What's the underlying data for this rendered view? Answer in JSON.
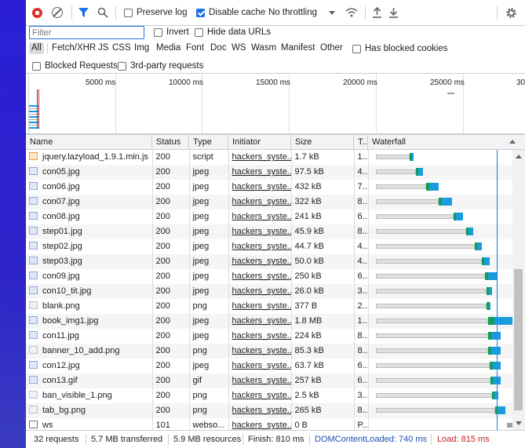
{
  "toolbar": {
    "preserve_log": "Preserve log",
    "disable_cache": "Disable cache",
    "throttling": "No throttling"
  },
  "filter": {
    "value": "Filter",
    "invert": "Invert",
    "hide_data_urls": "Hide data URLs",
    "types": [
      "All",
      "Fetch/XHR",
      "JS",
      "CSS",
      "Img",
      "Media",
      "Font",
      "Doc",
      "WS",
      "Wasm",
      "Manifest",
      "Other"
    ],
    "has_blocked_cookies": "Has blocked cookies",
    "blocked_requests": "Blocked Requests",
    "third_party": "3rd-party requests"
  },
  "overview": {
    "ticks": [
      "5000 ms",
      "10000 ms",
      "15000 ms",
      "20000 ms",
      "25000 ms",
      "30"
    ]
  },
  "columns": {
    "name": "Name",
    "status": "Status",
    "type": "Type",
    "initiator": "Initiator",
    "size": "Size",
    "time": "T...",
    "waterfall": "Waterfall"
  },
  "rows": [
    {
      "name": "jquery.lazyload_1.9.1.min.js",
      "status": "200",
      "type": "script",
      "initiator": "hackers_syste...",
      "size": "1.7 kB",
      "time": "1...",
      "icon": "js",
      "wf": [
        0.29,
        0.31
      ]
    },
    {
      "name": "con05.jpg",
      "status": "200",
      "type": "jpeg",
      "initiator": "hackers_syste...",
      "size": "97.5 kB",
      "time": "4...",
      "icon": "img",
      "wf": [
        0.33,
        0.38
      ]
    },
    {
      "name": "con06.jpg",
      "status": "200",
      "type": "jpeg",
      "initiator": "hackers_syste...",
      "size": "432 kB",
      "time": "7...",
      "icon": "img",
      "wf": [
        0.4,
        0.49
      ]
    },
    {
      "name": "con07.jpg",
      "status": "200",
      "type": "jpeg",
      "initiator": "hackers_syste...",
      "size": "322 kB",
      "time": "8...",
      "icon": "img",
      "wf": [
        0.49,
        0.58
      ]
    },
    {
      "name": "con08.jpg",
      "status": "200",
      "type": "jpeg",
      "initiator": "hackers_syste...",
      "size": "241 kB",
      "time": "6...",
      "icon": "img",
      "wf": [
        0.59,
        0.66
      ]
    },
    {
      "name": "step01.jpg",
      "status": "200",
      "type": "jpeg",
      "initiator": "hackers_syste...",
      "size": "45.9 kB",
      "time": "8...",
      "icon": "img",
      "wf": [
        0.68,
        0.73
      ]
    },
    {
      "name": "step02.jpg",
      "status": "200",
      "type": "jpeg",
      "initiator": "hackers_syste...",
      "size": "44.7 kB",
      "time": "4...",
      "icon": "img",
      "wf": [
        0.74,
        0.79
      ]
    },
    {
      "name": "step03.jpg",
      "status": "200",
      "type": "jpeg",
      "initiator": "hackers_syste...",
      "size": "50.0 kB",
      "time": "4...",
      "icon": "img",
      "wf": [
        0.79,
        0.84
      ]
    },
    {
      "name": "con09.jpg",
      "status": "200",
      "type": "jpeg",
      "initiator": "hackers_syste...",
      "size": "250 kB",
      "time": "6...",
      "icon": "img",
      "wf": [
        0.81,
        0.89
      ]
    },
    {
      "name": "con10_tit.jpg",
      "status": "200",
      "type": "jpeg",
      "initiator": "hackers_syste...",
      "size": "26.0 kB",
      "time": "3...",
      "icon": "img",
      "wf": [
        0.82,
        0.86
      ]
    },
    {
      "name": "blank.png",
      "status": "200",
      "type": "png",
      "initiator": "hackers_syste...",
      "size": "377 B",
      "time": "2...",
      "icon": "png",
      "wf": [
        0.82,
        0.85
      ]
    },
    {
      "name": "book_img1.jpg",
      "status": "200",
      "type": "jpeg",
      "initiator": "hackers_syste...",
      "size": "1.8 MB",
      "time": "1...",
      "icon": "img",
      "wf": [
        0.83,
        1.0
      ]
    },
    {
      "name": "con11.jpg",
      "status": "200",
      "type": "jpeg",
      "initiator": "hackers_syste...",
      "size": "224 kB",
      "time": "8...",
      "icon": "img",
      "wf": [
        0.83,
        0.92
      ]
    },
    {
      "name": "banner_10_add.png",
      "status": "200",
      "type": "png",
      "initiator": "hackers_syste...",
      "size": "85.3 kB",
      "time": "8...",
      "icon": "png",
      "wf": [
        0.83,
        0.92
      ]
    },
    {
      "name": "con12.jpg",
      "status": "200",
      "type": "jpeg",
      "initiator": "hackers_syste...",
      "size": "63.7 kB",
      "time": "6...",
      "icon": "img",
      "wf": [
        0.84,
        0.92
      ]
    },
    {
      "name": "con13.gif",
      "status": "200",
      "type": "gif",
      "initiator": "hackers_syste...",
      "size": "257 kB",
      "time": "6...",
      "icon": "img",
      "wf": [
        0.85,
        0.92
      ]
    },
    {
      "name": "ban_visible_1.png",
      "status": "200",
      "type": "png",
      "initiator": "hackers_syste...",
      "size": "2.5 kB",
      "time": "3...",
      "icon": "png",
      "wf": [
        0.86,
        0.9
      ]
    },
    {
      "name": "tab_bg.png",
      "status": "200",
      "type": "png",
      "initiator": "hackers_syste...",
      "size": "265 kB",
      "time": "8...",
      "icon": "png",
      "wf": [
        0.88,
        0.95
      ]
    },
    {
      "name": "ws",
      "status": "101",
      "type": "webso...",
      "initiator": "hackers_syste...",
      "size": "0 B",
      "time": "P...",
      "icon": "ws",
      "wf": [
        0.96,
        1.0
      ]
    }
  ],
  "status_bar": {
    "requests": "32 requests",
    "transferred": "5.7 MB transferred",
    "resources": "5.9 MB resources",
    "finish": "Finish: 810 ms",
    "dom": "DOMContentLoaded: 740 ms",
    "load": "Load: 815 ms",
    "dom_color": "#1a4fb5",
    "load_color": "#c5221f"
  }
}
